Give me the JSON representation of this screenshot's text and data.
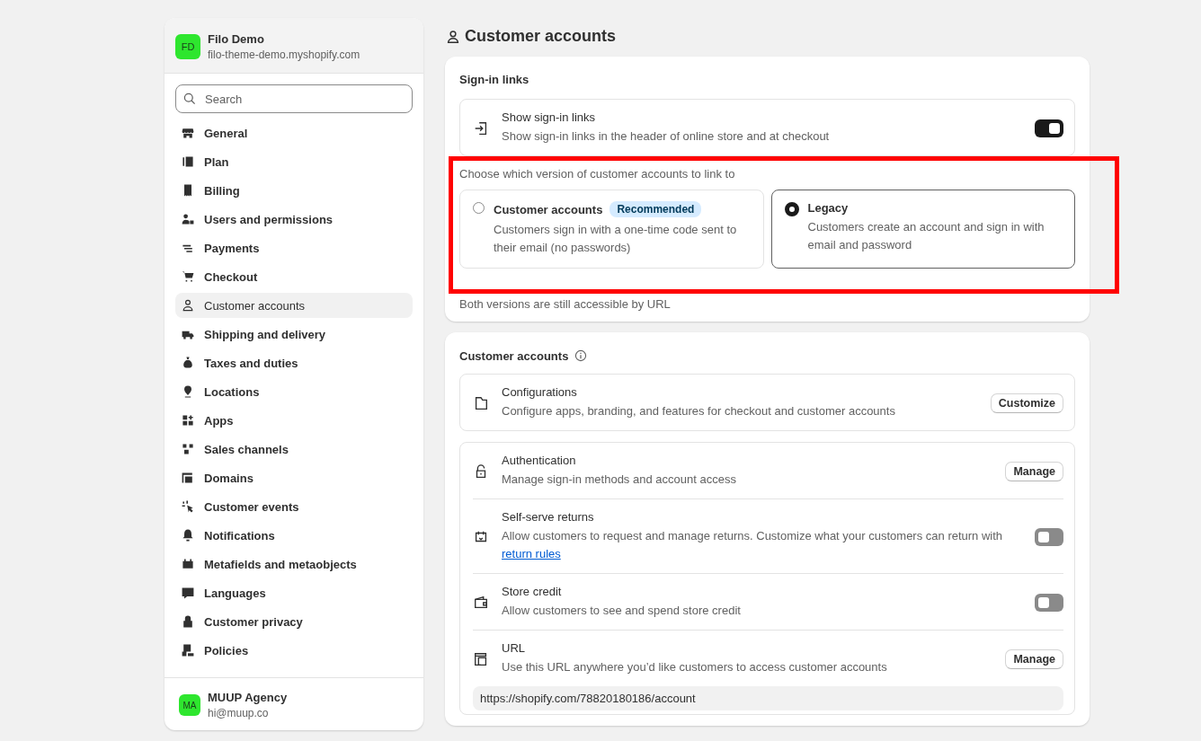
{
  "store": {
    "initials": "FD",
    "name": "Filo Demo",
    "domain": "filo-theme-demo.myshopify.com"
  },
  "search": {
    "placeholder": "Search"
  },
  "nav": [
    {
      "label": "General",
      "selected": false
    },
    {
      "label": "Plan",
      "selected": false
    },
    {
      "label": "Billing",
      "selected": false
    },
    {
      "label": "Users and permissions",
      "selected": false
    },
    {
      "label": "Payments",
      "selected": false
    },
    {
      "label": "Checkout",
      "selected": false
    },
    {
      "label": "Customer accounts",
      "selected": true
    },
    {
      "label": "Shipping and delivery",
      "selected": false
    },
    {
      "label": "Taxes and duties",
      "selected": false
    },
    {
      "label": "Locations",
      "selected": false
    },
    {
      "label": "Apps",
      "selected": false
    },
    {
      "label": "Sales channels",
      "selected": false
    },
    {
      "label": "Domains",
      "selected": false
    },
    {
      "label": "Customer events",
      "selected": false
    },
    {
      "label": "Notifications",
      "selected": false
    },
    {
      "label": "Metafields and metaobjects",
      "selected": false
    },
    {
      "label": "Languages",
      "selected": false
    },
    {
      "label": "Customer privacy",
      "selected": false
    },
    {
      "label": "Policies",
      "selected": false
    }
  ],
  "account": {
    "initials": "MA",
    "name": "MUUP Agency",
    "email": "hi@muup.co"
  },
  "page_title": "Customer accounts",
  "sign_in": {
    "heading": "Sign-in links",
    "setting": {
      "title": "Show sign-in links",
      "description": "Show sign-in links in the header of online store and at checkout",
      "on": true
    },
    "chooser": {
      "prompt": "Choose which version of customer accounts to link to",
      "highlighted": true,
      "options": [
        {
          "title": "Customer accounts",
          "badge": "Recommended",
          "description": "Customers sign in with a one-time code sent to their email (no passwords)",
          "selected": false
        },
        {
          "title": "Legacy",
          "description": "Customers create an account and sign in with email and password",
          "selected": true
        }
      ]
    },
    "footnote": "Both versions are still accessible by URL"
  },
  "accounts": {
    "heading": "Customer accounts",
    "groups": [
      [
        {
          "kind": "button",
          "title": "Configurations",
          "description": "Configure apps, branding, and features for checkout and customer accounts",
          "action": "Customize"
        }
      ],
      [
        {
          "kind": "button",
          "title": "Authentication",
          "description": "Manage sign-in methods and account access",
          "action": "Manage"
        },
        {
          "kind": "toggle",
          "title": "Self-serve returns",
          "description": "Allow customers to request and manage returns. Customize what your customers can return with",
          "link": "return rules",
          "on": false
        },
        {
          "kind": "toggle",
          "title": "Store credit",
          "description": "Allow customers to see and spend store credit",
          "on": false
        },
        {
          "kind": "button",
          "title": "URL",
          "description": "Use this URL anywhere you’d like customers to access customer accounts",
          "action": "Manage",
          "url": "https://shopify.com/78820180186/account"
        }
      ]
    ]
  }
}
